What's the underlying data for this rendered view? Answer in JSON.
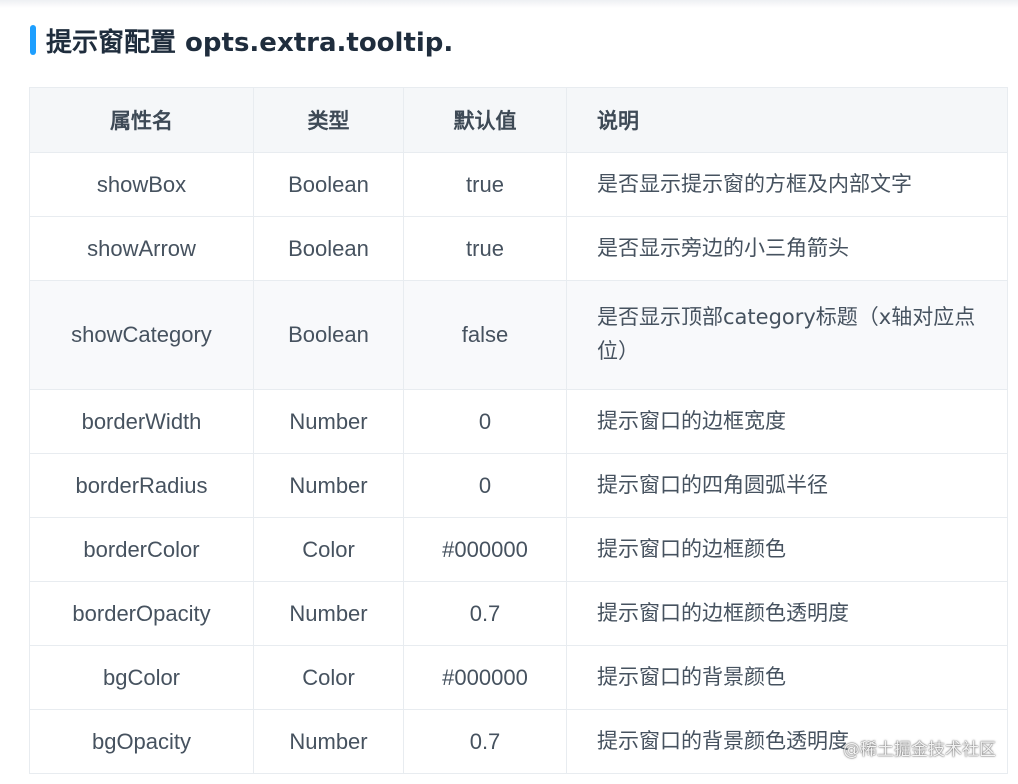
{
  "heading": "提示窗配置 opts.extra.tooltip.",
  "table": {
    "headers": [
      "属性名",
      "类型",
      "默认值",
      "说明"
    ],
    "rows": [
      {
        "name": "showBox",
        "type": "Boolean",
        "default": "true",
        "desc": "是否显示提示窗的方框及内部文字"
      },
      {
        "name": "showArrow",
        "type": "Boolean",
        "default": "true",
        "desc": "是否显示旁边的小三角箭头"
      },
      {
        "name": "showCategory",
        "type": "Boolean",
        "default": "false",
        "desc": "是否显示顶部category标题（x轴对应点位）"
      },
      {
        "name": "borderWidth",
        "type": "Number",
        "default": "0",
        "desc": "提示窗口的边框宽度"
      },
      {
        "name": "borderRadius",
        "type": "Number",
        "default": "0",
        "desc": "提示窗口的四角圆弧半径"
      },
      {
        "name": "borderColor",
        "type": "Color",
        "default": "#000000",
        "desc": "提示窗口的边框颜色"
      },
      {
        "name": "borderOpacity",
        "type": "Number",
        "default": "0.7",
        "desc": "提示窗口的边框颜色透明度"
      },
      {
        "name": "bgColor",
        "type": "Color",
        "default": "#000000",
        "desc": "提示窗口的背景颜色"
      },
      {
        "name": "bgOpacity",
        "type": "Number",
        "default": "0.7",
        "desc": "提示窗口的背景颜色透明度"
      }
    ]
  },
  "watermark": "@稀土掘金技术社区",
  "colors": {
    "accent": "#1e9fff",
    "header_bg": "#f5f7f9",
    "border": "#e8ecf0"
  }
}
